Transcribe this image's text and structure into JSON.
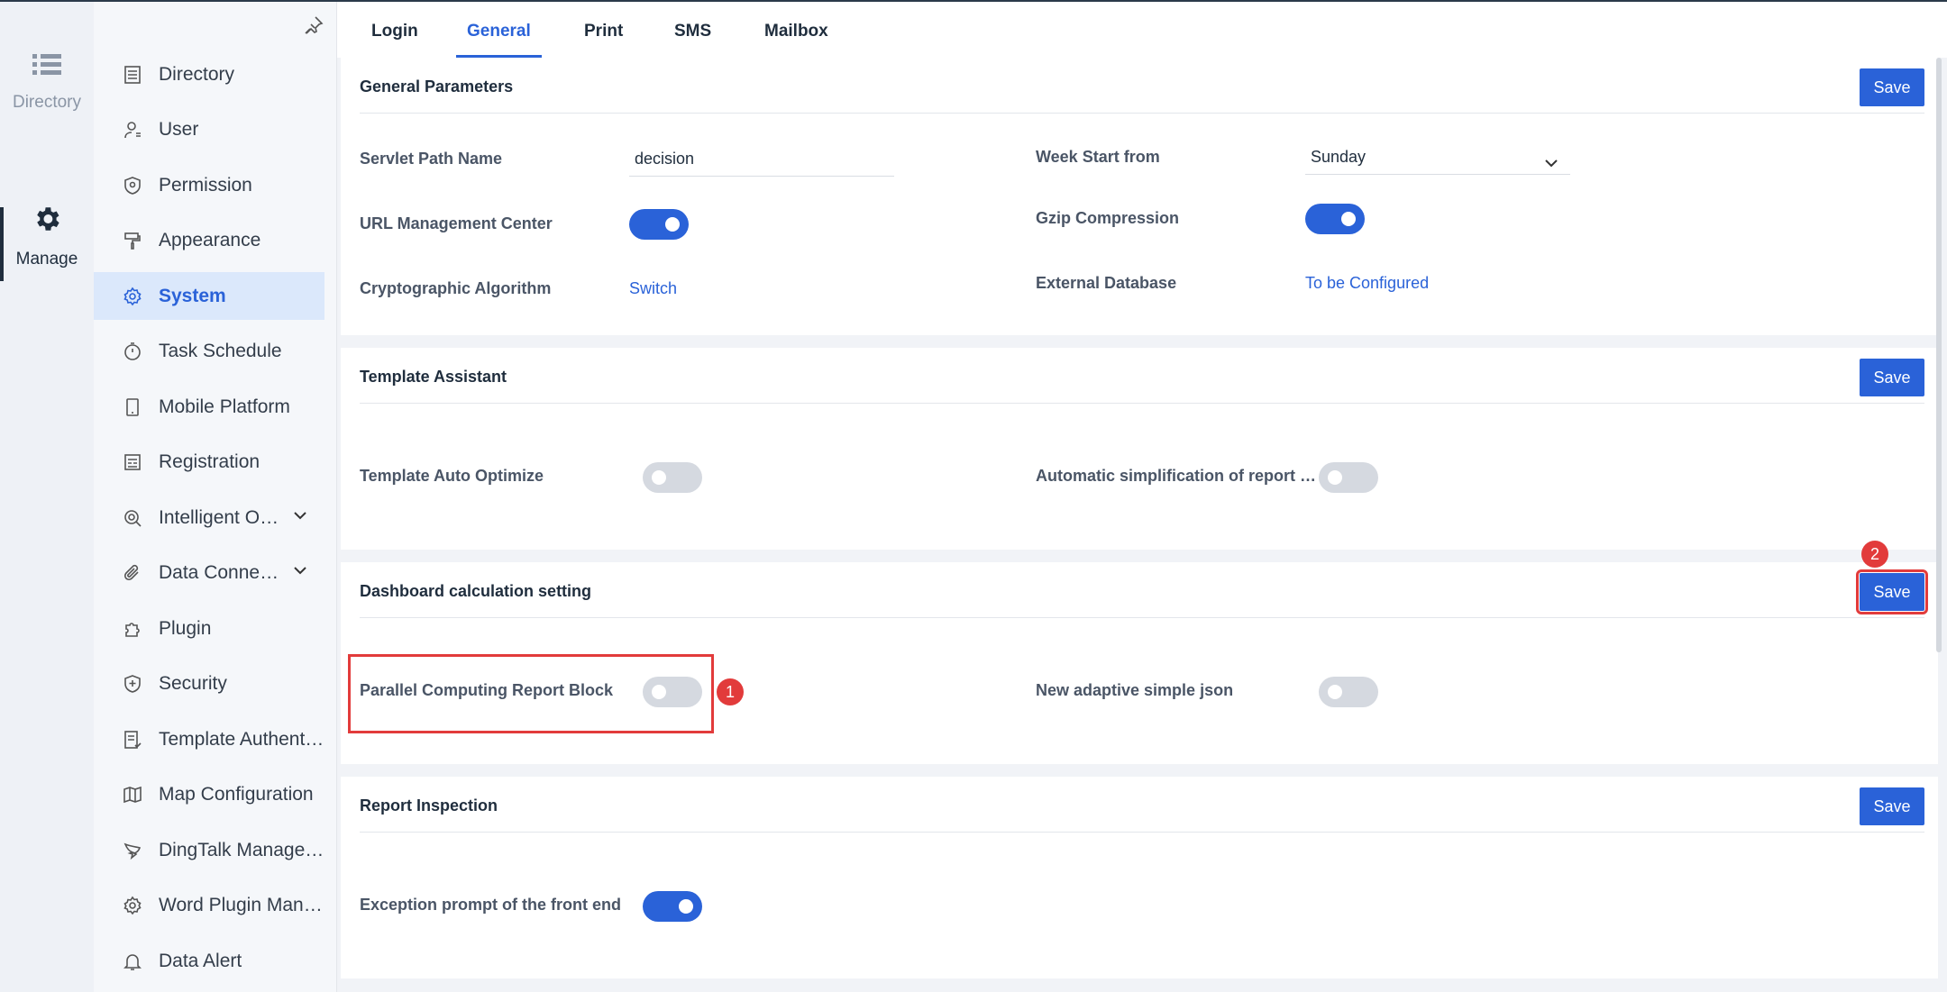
{
  "rail": {
    "items": [
      {
        "label": "Directory",
        "icon": "list-icon"
      },
      {
        "label": "Manage",
        "icon": "gear-icon"
      }
    ]
  },
  "nav": {
    "items": [
      {
        "label": "Directory",
        "icon": "document-icon"
      },
      {
        "label": "User",
        "icon": "user-icon"
      },
      {
        "label": "Permission",
        "icon": "shield-icon"
      },
      {
        "label": "Appearance",
        "icon": "paint-roller-icon"
      },
      {
        "label": "System",
        "icon": "gear-icon"
      },
      {
        "label": "Task Schedule",
        "icon": "timer-icon"
      },
      {
        "label": "Mobile Platform",
        "icon": "mobile-icon"
      },
      {
        "label": "Registration",
        "icon": "registration-icon"
      },
      {
        "label": "Intelligent Operation",
        "icon": "intelligent-icon"
      },
      {
        "label": "Data Connection",
        "icon": "paperclip-icon"
      },
      {
        "label": "Plugin",
        "icon": "puzzle-icon"
      },
      {
        "label": "Security",
        "icon": "shield-plus-icon"
      },
      {
        "label": "Template Authentication",
        "icon": "template-auth-icon"
      },
      {
        "label": "Map Configuration",
        "icon": "map-icon"
      },
      {
        "label": "DingTalk Management",
        "icon": "dingtalk-icon"
      },
      {
        "label": "Word Plugin Management",
        "icon": "gear-icon"
      },
      {
        "label": "Data Alert",
        "icon": "bell-icon"
      }
    ],
    "active_index": 4
  },
  "tabs": [
    {
      "label": "Login"
    },
    {
      "label": "General"
    },
    {
      "label": "Print"
    },
    {
      "label": "SMS"
    },
    {
      "label": "Mailbox"
    }
  ],
  "active_tab": "General",
  "save_label": "Save",
  "general": {
    "title": "General Parameters",
    "servlet_label": "Servlet Path Name",
    "servlet_value": "decision",
    "week_label": "Week Start from",
    "week_value": "Sunday",
    "url_label": "URL Management Center",
    "url_on": true,
    "gzip_label": "Gzip Compression",
    "gzip_on": true,
    "crypto_label": "Cryptographic Algorithm",
    "crypto_link": "Switch",
    "extdb_label": "External Database",
    "extdb_link": "To be Configured"
  },
  "template": {
    "title": "Template Assistant",
    "auto_opt_label": "Template Auto Optimize",
    "auto_opt_on": false,
    "auto_simp_label": "Automatic simplification of report block",
    "auto_simp_on": false
  },
  "dashboard": {
    "title": "Dashboard calculation setting",
    "parallel_label": "Parallel Computing Report Block",
    "parallel_on": false,
    "adaptive_label": "New adaptive simple json",
    "adaptive_on": false
  },
  "inspection": {
    "title": "Report Inspection",
    "exception_label": "Exception prompt of the front end",
    "exception_on": true
  },
  "annotations": {
    "badge1": "1",
    "badge2": "2"
  },
  "colors": {
    "accent": "#2a62d8",
    "highlight": "#e23b3b"
  }
}
